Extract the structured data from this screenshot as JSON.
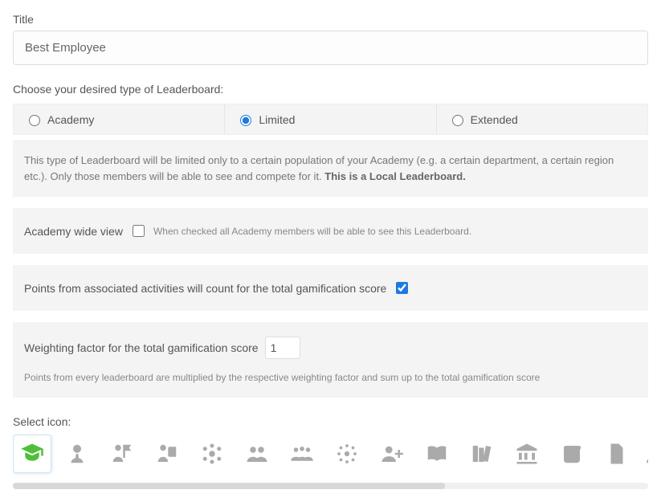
{
  "title": {
    "label": "Title",
    "value": "Best Employee"
  },
  "type": {
    "label": "Choose your desired type of Leaderboard:",
    "options": [
      "Academy",
      "Limited",
      "Extended"
    ],
    "selected": 1,
    "description_prefix": "This type of Leaderboard will be limited only to a certain population of your Academy (e.g. a certain department, a certain region etc.). Only those members will be able to see and compete for it. ",
    "description_bold": "This is a Local Leaderboard."
  },
  "academy_wide": {
    "label": "Academy wide view",
    "hint": "When checked all Academy members will be able to see this Leaderboard.",
    "checked": false
  },
  "points_count": {
    "label": "Points from associated activities will count for the total gamification score",
    "checked": true
  },
  "weighting": {
    "label": "Weighting factor for the total gamification score",
    "value": "1",
    "hint": "Points from every leaderboard are multiplied by the respective weighting factor and sum up to the total gamification score"
  },
  "icons": {
    "label": "Select icon:",
    "items": [
      "graduate-icon",
      "person-tie-icon",
      "person-flag-icon",
      "person-book-icon",
      "group-dots-icon",
      "group-three-icon",
      "crowd-icon",
      "sparkle-group-icon",
      "person-plus-icon",
      "open-book-icon",
      "books-icon",
      "bank-icon",
      "scroll-icon",
      "document-icon",
      "person-icon"
    ],
    "selected": 0
  }
}
